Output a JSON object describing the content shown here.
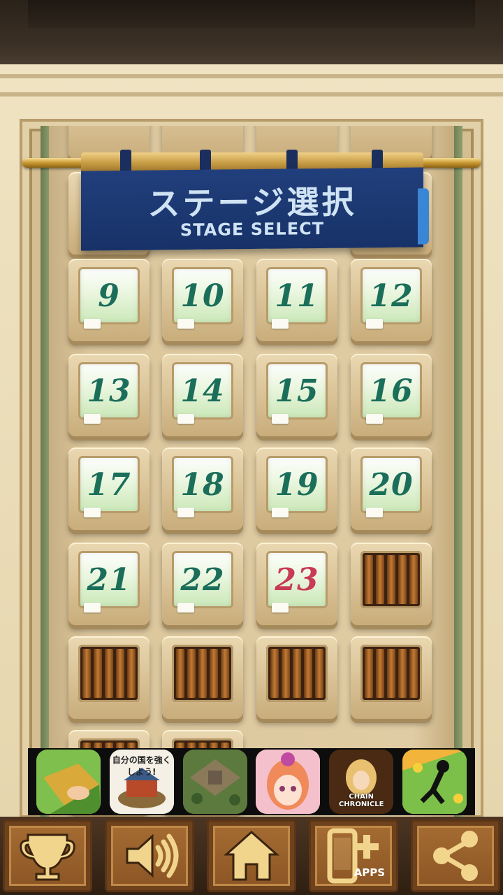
{
  "banner": {
    "title": "ステージ選択",
    "subtitle": "STAGE SELECT"
  },
  "stages": {
    "unlocked": [
      "9",
      "10",
      "11",
      "12",
      "13",
      "14",
      "15",
      "16",
      "17",
      "18",
      "19",
      "20",
      "21",
      "22"
    ],
    "current": "23",
    "locked_count": 5
  },
  "ads": {
    "ad2_text": "自分の国を強くしよう!",
    "ad5_text": "CHAIN CHRONICLE"
  },
  "bottom_bar": {
    "apps_label": "APPS"
  },
  "colors": {
    "banner": "#1c3a74",
    "stage_number": "#1b6e5a",
    "current_stage_number": "#c83a55",
    "button_wood": "#9a6129"
  }
}
